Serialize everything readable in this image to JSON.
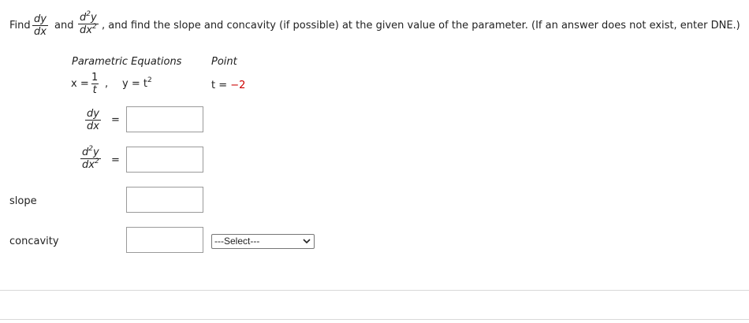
{
  "prompt": {
    "find": "Find",
    "and": "and",
    "rest": ", and find the slope and concavity (if possible) at the given value of the parameter. (If an answer does not exist, enter DNE.)"
  },
  "table": {
    "col1_header": "Parametric Equations",
    "col2_header": "Point",
    "x_eq_prefix": "x =",
    "x_num": "1",
    "x_den": "t",
    "y_eq": "y = t",
    "y_exp": "2",
    "point_prefix": "t = ",
    "point_value": "−2"
  },
  "answers": {
    "dy": "dy",
    "dx": "dx",
    "d2y_base": "d",
    "d2y_exp": "2",
    "d2y_tail": "y",
    "dx2_base": "dx",
    "dx2_exp": "2",
    "equals": "="
  },
  "labels": {
    "slope": "slope",
    "concavity": "concavity"
  },
  "select": {
    "selected": "---Select---"
  },
  "colors": {
    "point_value": "#cc0000",
    "divider": "#d9d9d9"
  }
}
